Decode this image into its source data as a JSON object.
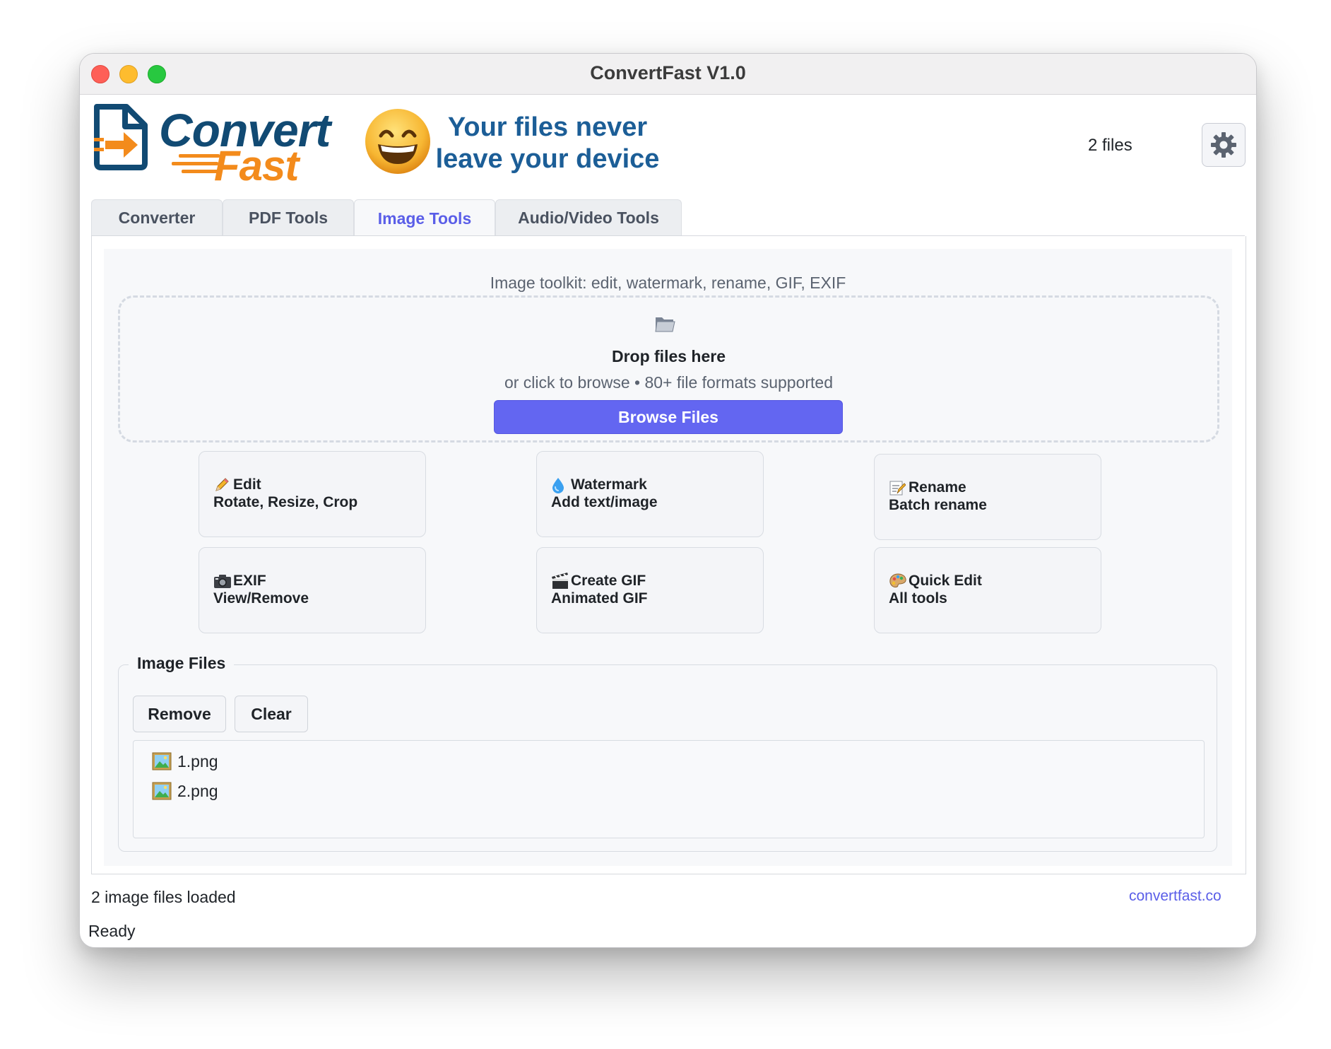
{
  "window": {
    "title": "ConvertFast V1.0"
  },
  "header": {
    "logo_line1": "Convert",
    "logo_line2": "Fast",
    "tagline_line1": "Your files never",
    "tagline_line2": "leave your device",
    "files_count": "2 files"
  },
  "tabs": [
    {
      "label": "Converter"
    },
    {
      "label": "PDF Tools"
    },
    {
      "label": "Image Tools",
      "active": true
    },
    {
      "label": "Audio/Video Tools"
    }
  ],
  "image_tools": {
    "subtitle": "Image toolkit: edit, watermark, rename, GIF, EXIF",
    "dropzone": {
      "title": "Drop files here",
      "subtitle": "or click to browse • 80+ file formats supported",
      "browse_label": "Browse Files"
    },
    "tools": [
      {
        "icon": "pencil-icon",
        "title": "Edit",
        "desc": "Rotate, Resize, Crop"
      },
      {
        "icon": "droplet-icon",
        "title": "Watermark",
        "desc": "Add text/image"
      },
      {
        "icon": "memo-icon",
        "title": "Rename",
        "desc": "Batch rename"
      },
      {
        "icon": "camera-icon",
        "title": "EXIF",
        "desc": "View/Remove"
      },
      {
        "icon": "clapper-icon",
        "title": "Create GIF",
        "desc": "Animated GIF"
      },
      {
        "icon": "palette-icon",
        "title": "Quick Edit",
        "desc": "All tools"
      }
    ],
    "files_group": {
      "label": "Image Files",
      "remove_label": "Remove",
      "clear_label": "Clear",
      "files": [
        {
          "name": "1.png",
          "icon": "picture-icon"
        },
        {
          "name": "2.png",
          "icon": "picture-icon"
        }
      ]
    }
  },
  "status": {
    "message": "2 image files loaded",
    "link": "convertfast.co",
    "ready": "Ready"
  },
  "colors": {
    "accent": "#6366f1",
    "brand_blue": "#114a73",
    "brand_orange": "#f38b1c"
  }
}
